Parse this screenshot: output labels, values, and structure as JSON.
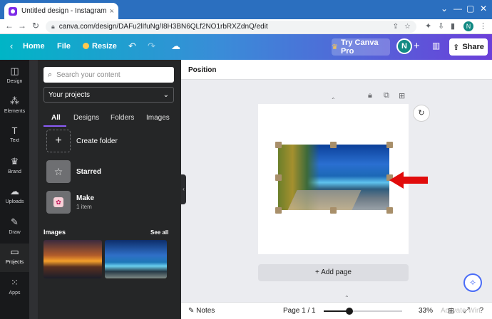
{
  "browser": {
    "tab_title": "Untitled design - Instagram Post",
    "tab_close": "×",
    "new_tab": "+",
    "url": "canva.com/design/DAFu2lIfuNg/I8H3BN6QLf2NO1rbRXZdnQ/edit",
    "profile_initial": "N",
    "win_minimize": "—",
    "win_maximize": "▢",
    "win_close": "✕"
  },
  "header": {
    "home": "Home",
    "file": "File",
    "resize": "Resize",
    "try_canva_pro": "Try Canva Pro",
    "avatar_initial": "N",
    "share": "Share"
  },
  "rail": {
    "items": [
      {
        "label": "Design",
        "icon": "◫"
      },
      {
        "label": "Elements",
        "icon": "⁂"
      },
      {
        "label": "Text",
        "icon": "T"
      },
      {
        "label": "Brand",
        "icon": "♛"
      },
      {
        "label": "Uploads",
        "icon": "☁"
      },
      {
        "label": "Draw",
        "icon": "✎"
      },
      {
        "label": "Projects",
        "icon": "▭"
      },
      {
        "label": "Apps",
        "icon": "⁙"
      }
    ]
  },
  "panel": {
    "search_placeholder": "Search your content",
    "dropdown_value": "Your projects",
    "tabs": [
      "All",
      "Designs",
      "Folders",
      "Images"
    ],
    "folders": [
      {
        "name": "Create folder",
        "sub": ""
      },
      {
        "name": "Starred",
        "sub": ""
      },
      {
        "name": "Make",
        "sub": "1 item"
      }
    ],
    "images_heading": "Images",
    "see_all": "See all"
  },
  "editor": {
    "toolbar_label": "Position",
    "add_page": "+ Add page",
    "notes": "Notes",
    "page_indicator": "Page 1 / 1",
    "zoom_value": 33,
    "zoom_label": "33%",
    "watermark": "Activate Win"
  },
  "colors": {
    "header_gradient_start": "#00b5c6",
    "header_gradient_end": "#6b3fd9",
    "arrow": "#e10c0c",
    "accent_underline": "#8b5cf6"
  }
}
